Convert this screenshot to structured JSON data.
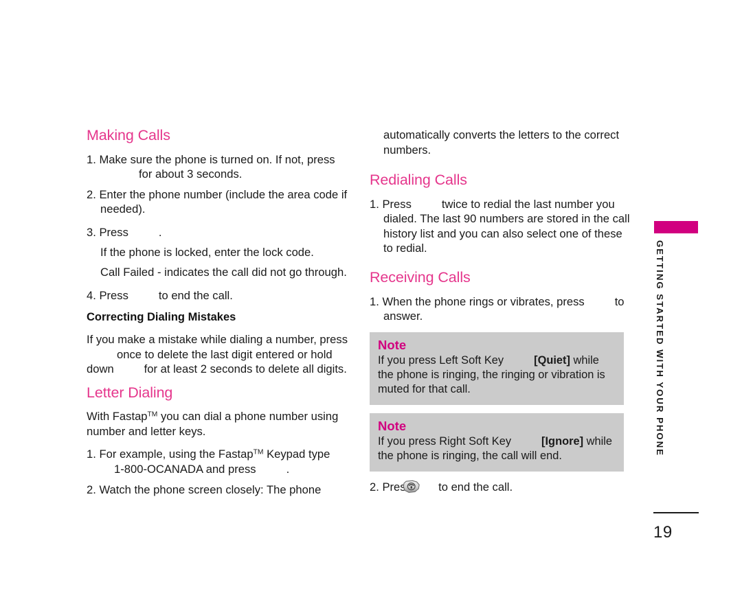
{
  "page": {
    "number": "19",
    "accent_heading_color": "#E5368C",
    "accent_deep_color": "#D1007F",
    "note_bg_color": "#cbcbcb",
    "text_color": "#1a1a1a"
  },
  "sidebar": {
    "label": "GETTING STARTED WITH YOUR PHONE"
  },
  "left_column": {
    "making_calls": {
      "heading": "Making Calls",
      "step1_a": "1. Make sure the phone is turned on. If not, press",
      "step1_b": "for about 3 seconds.",
      "step2": "2. Enter the phone number (include the area code if needed).",
      "step3_a": "3. Press",
      "step3_b": ".",
      "note_locked": "If the phone is locked, enter the lock code.",
      "note_failed": "Call Failed - indicates the call did not go through.",
      "step4_a": "4. Press",
      "step4_b": "to end the call."
    },
    "correcting": {
      "heading": "Correcting Dialing Mistakes",
      "text_a": "If you make a mistake while dialing a number, press",
      "text_b": "once to delete the last digit entered or hold",
      "text_c": "down",
      "text_d": "for at least 2 seconds to delete all digits."
    },
    "letter_dialing": {
      "heading": "Letter Dialing",
      "intro_pre": "With Fastap",
      "intro_tm": "TM",
      "intro_post": " you can dial a phone number using number and letter keys.",
      "step1_pre": "1. For example, using the Fastap",
      "step1_tm": "TM",
      "step1_post": " Keypad type",
      "step1_line2_a": "1-800-OCANADA and press",
      "step1_line2_b": ".",
      "step2": "2. Watch the phone screen closely: The phone"
    }
  },
  "right_column": {
    "continuation": "automatically converts the letters to the correct numbers.",
    "redialing": {
      "heading": "Redialing Calls",
      "step1_a": "1. Press",
      "step1_b": "twice to redial the last number you dialed. The last 90 numbers are stored in the call history list and you can also select one of these to redial."
    },
    "receiving": {
      "heading": "Receiving Calls",
      "step1_a": "1. When the phone rings or vibrates, press",
      "step1_b": "to answer.",
      "step2_a": "2. Press",
      "step2_b": "to end the call."
    },
    "notes": [
      {
        "title": "Note",
        "text_a": "If you press Left Soft Key",
        "text_bold": "[Quiet]",
        "text_b": " while the phone is ringing, the ringing or vibration is muted for that call."
      },
      {
        "title": "Note",
        "text_a": "If you press Right Soft Key",
        "text_bold": "[Ignore]",
        "text_b": " while the phone is ringing, the call will end."
      }
    ]
  }
}
